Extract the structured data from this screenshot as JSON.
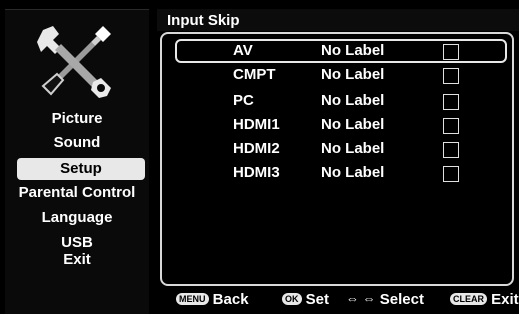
{
  "sidebar": {
    "icon": "tools-icon",
    "items": [
      {
        "label": "Picture"
      },
      {
        "label": "Sound"
      },
      {
        "label": "Setup",
        "selected": true
      },
      {
        "label": "Parental Control"
      },
      {
        "label": "Language"
      },
      {
        "label": "USB"
      },
      {
        "label": "Exit"
      }
    ]
  },
  "header": {
    "title": "Input Skip"
  },
  "inputs": [
    {
      "name": "AV",
      "label": "No Label",
      "skipped": false,
      "focused": true
    },
    {
      "name": "CMPT",
      "label": "No Label",
      "skipped": false
    },
    {
      "name": "PC",
      "label": "No Label",
      "skipped": false
    },
    {
      "name": "HDMI1",
      "label": "No Label",
      "skipped": false
    },
    {
      "name": "HDMI2",
      "label": "No Label",
      "skipped": false
    },
    {
      "name": "HDMI3",
      "label": "No Label",
      "skipped": false
    }
  ],
  "footer": {
    "back": {
      "key": "MENU",
      "label": "Back"
    },
    "set": {
      "key": "OK",
      "label": "Set"
    },
    "select": {
      "key_icon": "left-right-arrows-icon",
      "label": "Select"
    },
    "exit": {
      "key": "CLEAR",
      "label": "Exit"
    }
  },
  "colors": {
    "background": "#000000",
    "text": "#ffffff",
    "highlight": "#e8e8e8"
  }
}
